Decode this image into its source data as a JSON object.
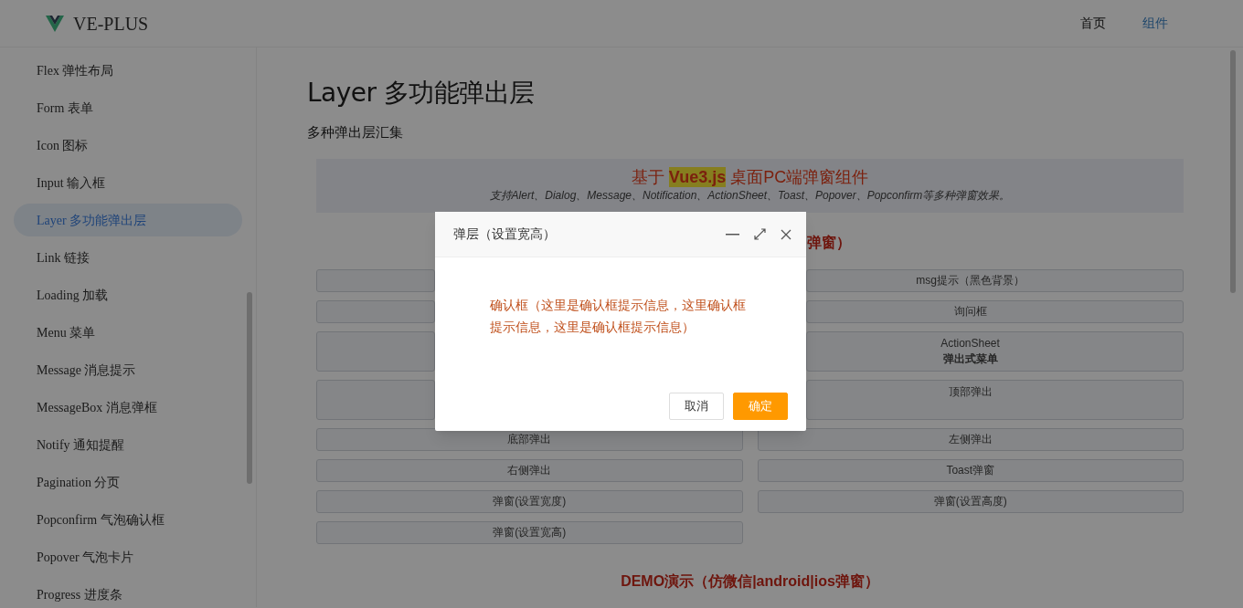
{
  "header": {
    "logo_text": "VE-PLUS",
    "nav": [
      {
        "label": "首页",
        "selected": false
      },
      {
        "label": "组件",
        "selected": true
      }
    ]
  },
  "sidebar": {
    "items": [
      {
        "label": "Flex 弹性布局",
        "selected": false
      },
      {
        "label": "Form 表单",
        "selected": false
      },
      {
        "label": "Icon 图标",
        "selected": false
      },
      {
        "label": "Input 输入框",
        "selected": false
      },
      {
        "label": "Layer 多功能弹出层",
        "selected": true
      },
      {
        "label": "Link 链接",
        "selected": false
      },
      {
        "label": "Loading 加载",
        "selected": false
      },
      {
        "label": "Menu 菜单",
        "selected": false
      },
      {
        "label": "Message 消息提示",
        "selected": false
      },
      {
        "label": "MessageBox 消息弹框",
        "selected": false
      },
      {
        "label": "Notify 通知提醒",
        "selected": false
      },
      {
        "label": "Pagination 分页",
        "selected": false
      },
      {
        "label": "Popconfirm 气泡确认框",
        "selected": false
      },
      {
        "label": "Popover 气泡卡片",
        "selected": false
      },
      {
        "label": "Progress 进度条",
        "selected": false
      }
    ]
  },
  "page": {
    "title": "Layer 多功能弹出层",
    "subtitle": "多种弹出层汇集",
    "banner": {
      "title_prefix": "基于",
      "title_highlight": "Vue3.js",
      "title_suffix": "桌面PC端弹窗组件",
      "description": "支持Alert、Dialog、Message、Notification、ActionSheet、Toast、Popover、Popconfirm等多种弹窗效果。"
    },
    "section_heading": "弹窗）",
    "buttons": [
      {
        "kind": "single"
      },
      {
        "kind": "single",
        "label": "msg提示（黑色背景）"
      },
      {
        "kind": "single"
      },
      {
        "kind": "single",
        "label": "询问框"
      },
      {
        "kind": "double"
      },
      {
        "kind": "double",
        "label": "ActionSheet",
        "sublabel": "弹出式菜单"
      },
      {
        "kind": "double"
      },
      {
        "kind": "double",
        "label": "顶部弹出"
      },
      {
        "kind": "single",
        "label": "底部弹出"
      },
      {
        "kind": "single",
        "label": "左侧弹出"
      },
      {
        "kind": "single",
        "label": "右侧弹出"
      },
      {
        "kind": "single",
        "label": "Toast弹窗"
      },
      {
        "kind": "single",
        "label": "弹窗(设置宽度)"
      },
      {
        "kind": "single",
        "label": "弹窗(设置高度)"
      },
      {
        "kind": "single",
        "label": "弹窗(设置宽高)"
      }
    ],
    "demo_heading": "DEMO演示（仿微信|android|ios弹窗）"
  },
  "dialog": {
    "title": "弹层（设置宽高）",
    "message": "确认框（这里是确认框提示信息，这里确认框提示信息，这里是确认框提示信息）",
    "buttons": [
      {
        "label": "取消",
        "kind": "secondary"
      },
      {
        "label": "确定",
        "kind": "primary"
      }
    ]
  }
}
